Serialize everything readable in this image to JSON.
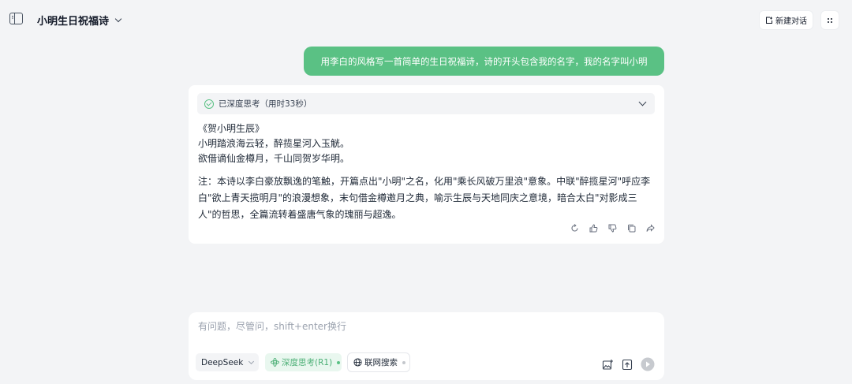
{
  "header": {
    "conversation_title": "小明生日祝福诗",
    "new_chat_label": "新建对话"
  },
  "user_message": "用李白的风格写一首简单的生日祝福诗，诗的开头包含我的名字，我的名字叫小明",
  "assistant": {
    "thinking_status": "已深度思考（用时33秒）",
    "poem_lines": [
      "《贺小明生辰》",
      "小明踏浪海云轻，醉揽星河入玉觥。",
      "欲借谪仙金樽月，千山同贺岁华明。"
    ],
    "note_lines": [
      "注：本诗以李白豪放飘逸的笔触，开篇点出\"小明\"之名，化用\"乘长风破万里浪\"意象。中联\"醉揽星河\"呼应李",
      "白\"欲上青天揽明月\"的浪漫想象，末句借金樽邀月之典，喻示生辰与天地同庆之意境，暗合太白\"对影成三",
      "人\"的哲思，全篇流转着盛唐气象的瑰丽与超逸。"
    ],
    "action_icons": [
      "regenerate-icon",
      "thumbs-up-icon",
      "thumbs-down-icon",
      "copy-icon",
      "share-icon"
    ]
  },
  "composer": {
    "placeholder": "有问题，尽管问，shift+enter换行",
    "model_label": "DeepSeek",
    "deep_think_label": "深度思考(R1)",
    "web_search_label": "联网搜索"
  },
  "colors": {
    "accent": "#5ac184",
    "background": "#f3f4f6",
    "card": "#ffffff"
  }
}
